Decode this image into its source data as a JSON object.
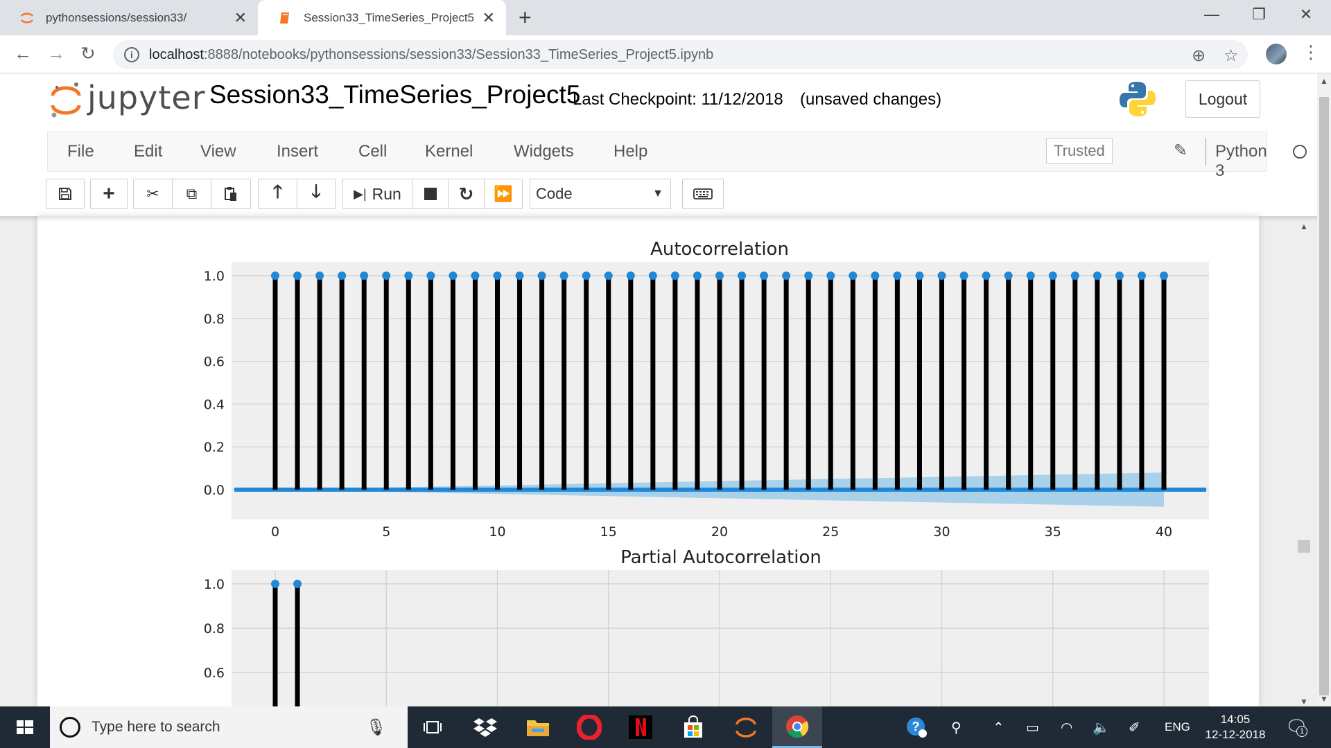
{
  "browser": {
    "tabs": [
      {
        "title": "pythonsessions/session33/",
        "active": false
      },
      {
        "title": "Session33_TimeSeries_Project5",
        "active": true
      }
    ],
    "new_tab": "+",
    "url_host": "localhost",
    "url_rest": ":8888/notebooks/pythonsessions/session33/Session33_TimeSeries_Project5.ipynb"
  },
  "jupyter": {
    "logo_text": "jupyter",
    "notebook_name": "Session33_TimeSeries_Project5",
    "checkpoint": "Last Checkpoint: 11/12/2018",
    "unsaved": "(unsaved changes)",
    "logout": "Logout",
    "menu": [
      "File",
      "Edit",
      "View",
      "Insert",
      "Cell",
      "Kernel",
      "Widgets",
      "Help"
    ],
    "trusted": "Trusted",
    "kernel": "Python 3",
    "run_label": "Run",
    "cell_type": "Code",
    "colors": {
      "orange": "#f37726",
      "stem": "#000000",
      "marker": "#1f88d9",
      "confidence": "#9ccbe9"
    }
  },
  "chart_data": [
    {
      "type": "stem",
      "title": "Autocorrelation",
      "xlabel": "",
      "ylabel": "",
      "x": [
        0,
        1,
        2,
        3,
        4,
        5,
        6,
        7,
        8,
        9,
        10,
        11,
        12,
        13,
        14,
        15,
        16,
        17,
        18,
        19,
        20,
        21,
        22,
        23,
        24,
        25,
        26,
        27,
        28,
        29,
        30,
        31,
        32,
        33,
        34,
        35,
        36,
        37,
        38,
        39,
        40
      ],
      "values": [
        1,
        1,
        1,
        1,
        1,
        1,
        1,
        1,
        1,
        1,
        1,
        1,
        1,
        1,
        1,
        1,
        1,
        1,
        1,
        1,
        1,
        1,
        1,
        1,
        1,
        1,
        1,
        1,
        1,
        1,
        1,
        1,
        1,
        1,
        1,
        1,
        1,
        1,
        1,
        1,
        1
      ],
      "confidence_band": {
        "x": [
          0,
          5,
          10,
          15,
          20,
          25,
          30,
          35,
          40
        ],
        "upper": [
          0.0,
          0.01,
          0.02,
          0.03,
          0.04,
          0.05,
          0.06,
          0.07,
          0.08
        ],
        "lower": [
          0.0,
          -0.01,
          -0.02,
          -0.03,
          -0.04,
          -0.05,
          -0.06,
          -0.07,
          -0.08
        ]
      },
      "xticks": [
        0,
        5,
        10,
        15,
        20,
        25,
        30,
        35,
        40
      ],
      "yticks": [
        "0.0",
        "0.2",
        "0.4",
        "0.6",
        "0.8",
        "1.0"
      ],
      "xlim": [
        -2,
        42
      ],
      "ylim": [
        -0.1,
        1.05
      ],
      "grid": true
    },
    {
      "type": "stem",
      "title": "Partial Autocorrelation",
      "xlabel": "",
      "ylabel": "",
      "x": [
        0,
        1
      ],
      "values": [
        1.0,
        1.0
      ],
      "xtick_grid": [
        0,
        5,
        10,
        15,
        20,
        25,
        30,
        35,
        40
      ],
      "yticks": [
        "0.6",
        "0.8",
        "1.0"
      ],
      "xlim": [
        -2,
        42
      ],
      "ylim": [
        0.4,
        1.05
      ],
      "grid": true,
      "note": ""
    }
  ],
  "taskbar": {
    "search_placeholder": "Type here to search",
    "lang": "ENG",
    "time": "14:05",
    "date": "12-12-2018",
    "notification_count": "1"
  }
}
